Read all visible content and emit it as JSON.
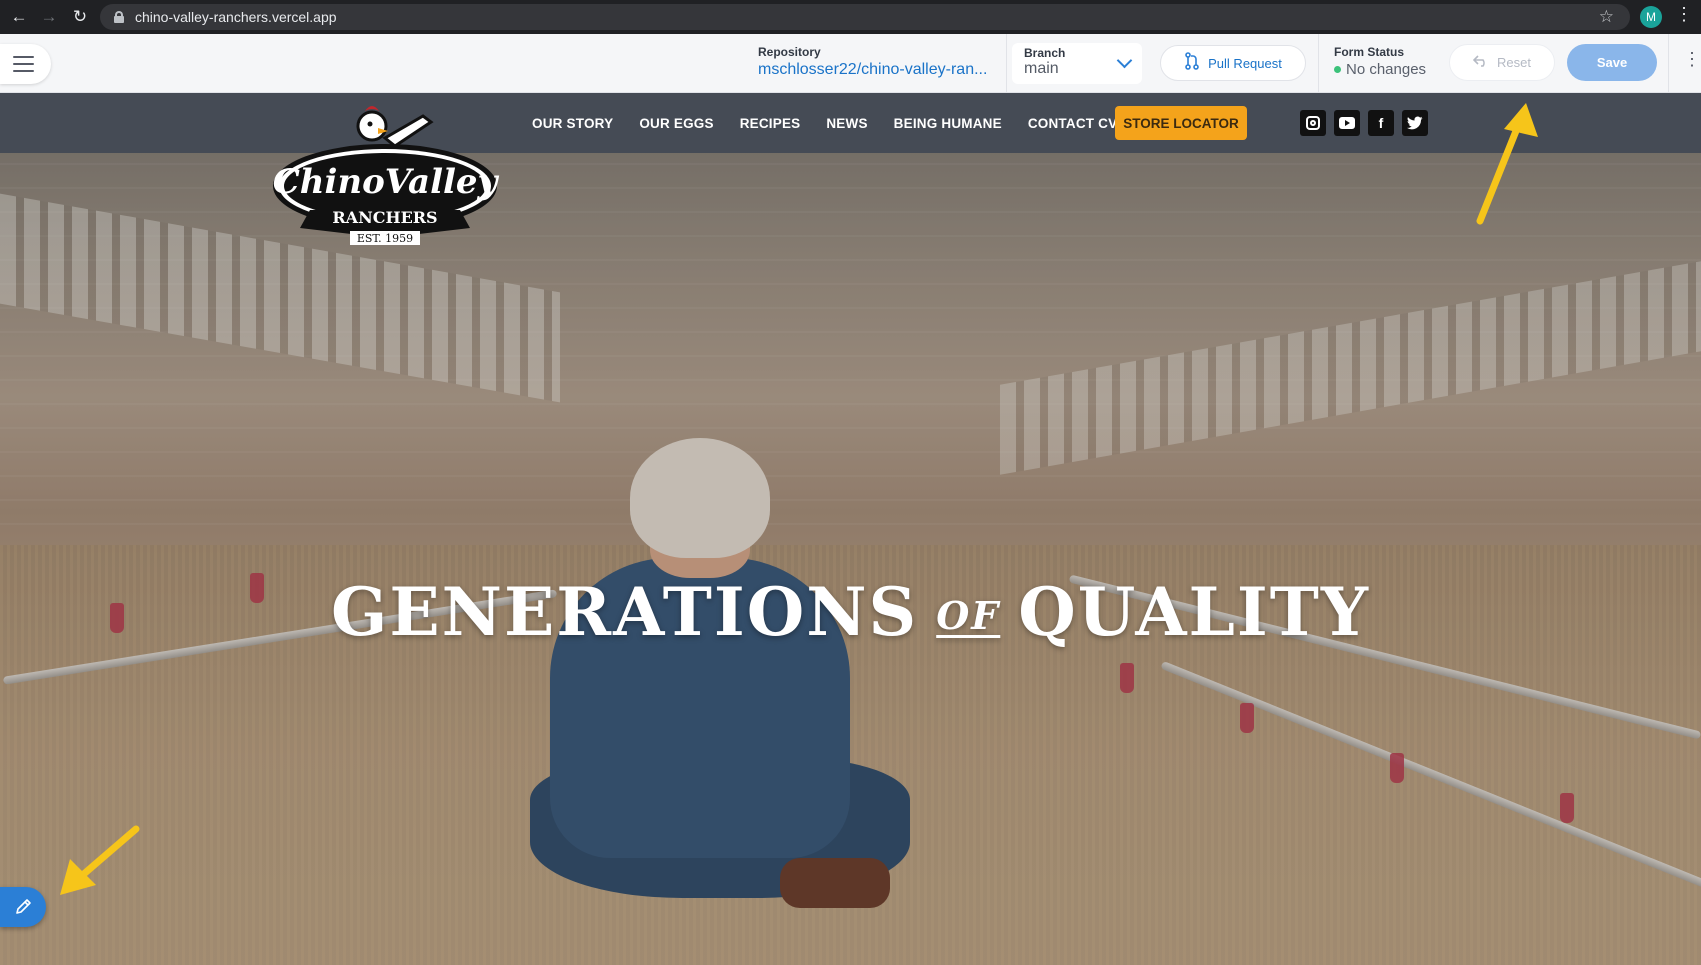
{
  "browser": {
    "url": "chino-valley-ranchers.vercel.app",
    "profile_initial": "M"
  },
  "toolbar": {
    "repository_label": "Repository",
    "repository_value": "mschlosser22/chino-valley-ran...",
    "branch_label": "Branch",
    "branch_value": "main",
    "pull_request_label": "Pull Request",
    "form_status_label": "Form Status",
    "form_status_value": "No changes",
    "reset_label": "Reset",
    "save_label": "Save"
  },
  "site": {
    "logo": {
      "brand_line1": "ChinoValley",
      "brand_line2": "RANCHERS",
      "established": "EST. 1959"
    },
    "nav": [
      {
        "label": "OUR STORY"
      },
      {
        "label": "OUR EGGS"
      },
      {
        "label": "RECIPES"
      },
      {
        "label": "NEWS"
      },
      {
        "label": "BEING HUMANE"
      },
      {
        "label": "CONTACT CVR"
      }
    ],
    "store_locator_label": "STORE LOCATOR",
    "socials": [
      "instagram-icon",
      "youtube-icon",
      "facebook-icon",
      "twitter-icon"
    ],
    "hero": {
      "headline_part1": "GENERATIONS",
      "headline_part2": "OF",
      "headline_part3": "QUALITY"
    }
  },
  "colors": {
    "accent_blue": "#2b7fd6",
    "save_button": "#8ab6ea",
    "store_locator": "#f4a31b",
    "site_nav": "#454b55",
    "annotation_arrow": "#f6c51a",
    "status_dot": "#3bc27a"
  }
}
